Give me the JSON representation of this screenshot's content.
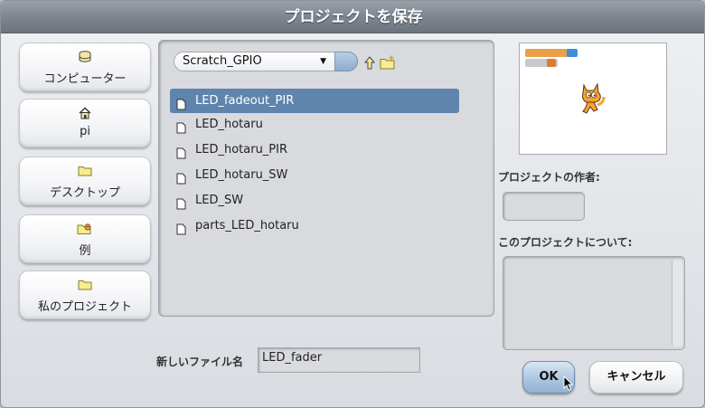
{
  "dialog": {
    "title": "プロジェクトを保存"
  },
  "sidebar": {
    "items": [
      {
        "label": "コンピューター",
        "icon": "drive-icon"
      },
      {
        "label": "pi",
        "icon": "home-icon"
      },
      {
        "label": "デスクトップ",
        "icon": "folder-icon"
      },
      {
        "label": "例",
        "icon": "examples-icon"
      },
      {
        "label": "私のプロジェクト",
        "icon": "folder-icon"
      }
    ]
  },
  "browser": {
    "current_folder": "Scratch_GPIO",
    "files": [
      {
        "name": "LED_fadeout_PIR",
        "selected": true
      },
      {
        "name": "LED_hotaru",
        "selected": false
      },
      {
        "name": "LED_hotaru_PIR",
        "selected": false
      },
      {
        "name": "LED_hotaru_SW",
        "selected": false
      },
      {
        "name": "LED_SW",
        "selected": false
      },
      {
        "name": "parts_LED_hotaru",
        "selected": false
      }
    ]
  },
  "info": {
    "author_label": "プロジェクトの作者:",
    "author_value": "",
    "about_label": "このプロジェクトについて:",
    "about_value": ""
  },
  "save": {
    "filename_label": "新しいファイル名",
    "filename_value": "LED_fader",
    "ok_label": "OK",
    "cancel_label": "キャンセル"
  },
  "colors": {
    "selection": "#5f84ad",
    "titlebar": "#7c838d",
    "ok_button": "#a9c3de"
  }
}
